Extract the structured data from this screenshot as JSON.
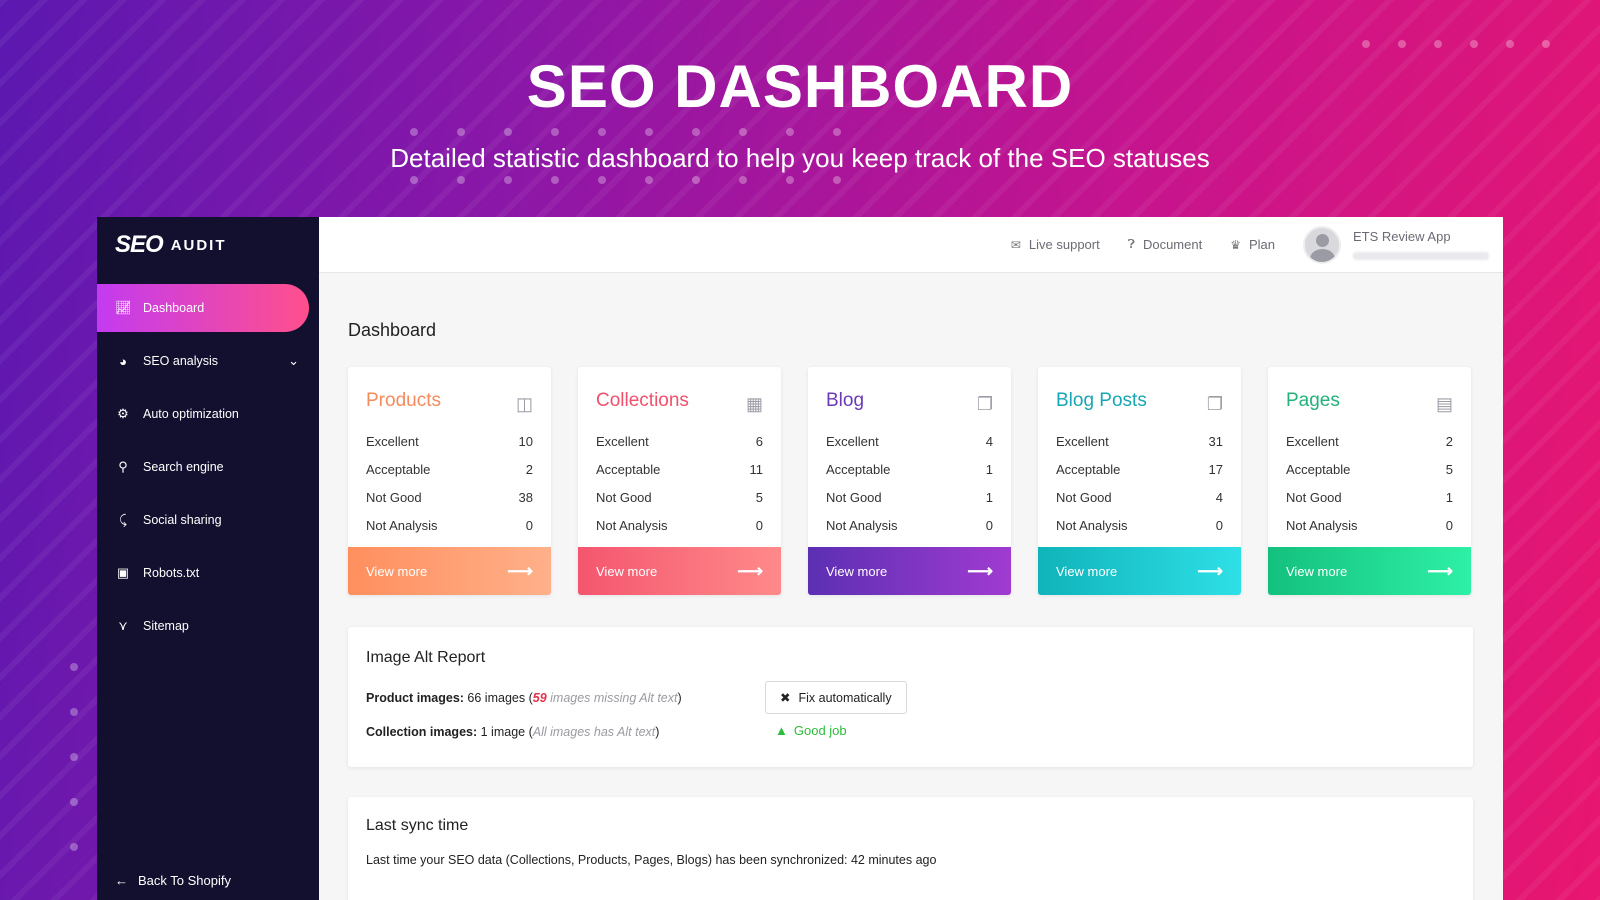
{
  "hero": {
    "title": "SEO DASHBOARD",
    "subtitle": "Detailed statistic dashboard to help you keep track of the SEO statuses"
  },
  "logo": {
    "part1": "SEO",
    "part2": "AUDIT"
  },
  "sidebar": {
    "items": [
      {
        "label": "Dashboard",
        "icon": "chart-icon",
        "active": true
      },
      {
        "label": "SEO analysis",
        "icon": "pie-icon",
        "has_chevron": true
      },
      {
        "label": "Auto optimization",
        "icon": "gears-icon"
      },
      {
        "label": "Search engine",
        "icon": "search-icon"
      },
      {
        "label": "Social sharing",
        "icon": "share-icon"
      },
      {
        "label": "Robots.txt",
        "icon": "robot-icon"
      },
      {
        "label": "Sitemap",
        "icon": "sitemap-icon"
      }
    ],
    "back_label": "Back To Shopify"
  },
  "topbar": {
    "live_support": "Live support",
    "document": "Document",
    "plan": "Plan",
    "user_name": "ETS Review App"
  },
  "page_title": "Dashboard",
  "cards": [
    {
      "title": "Products",
      "color": "#f48b5e",
      "foot_from": "#ff8f5e",
      "foot_to": "#ffb08a",
      "icon": "box-icon",
      "rows": [
        [
          "Excellent",
          "10"
        ],
        [
          "Acceptable",
          "2"
        ],
        [
          "Not Good",
          "38"
        ],
        [
          "Not Analysis",
          "0"
        ]
      ],
      "more": "View more"
    },
    {
      "title": "Collections",
      "color": "#f0506e",
      "foot_from": "#f4566f",
      "foot_to": "#ff8a8a",
      "icon": "boxes-icon",
      "rows": [
        [
          "Excellent",
          "6"
        ],
        [
          "Acceptable",
          "11"
        ],
        [
          "Not Good",
          "5"
        ],
        [
          "Not Analysis",
          "0"
        ]
      ],
      "more": "View more"
    },
    {
      "title": "Blog",
      "color": "#6a3ab8",
      "foot_from": "#5b2fb3",
      "foot_to": "#a03bd0",
      "icon": "copy-icon",
      "rows": [
        [
          "Excellent",
          "4"
        ],
        [
          "Acceptable",
          "1"
        ],
        [
          "Not Good",
          "1"
        ],
        [
          "Not Analysis",
          "0"
        ]
      ],
      "more": "View more"
    },
    {
      "title": "Blog Posts",
      "color": "#16a6b6",
      "foot_from": "#10b3ba",
      "foot_to": "#2ee0e6",
      "icon": "copy-icon",
      "rows": [
        [
          "Excellent",
          "31"
        ],
        [
          "Acceptable",
          "17"
        ],
        [
          "Not Good",
          "4"
        ],
        [
          "Not Analysis",
          "0"
        ]
      ],
      "more": "View more"
    },
    {
      "title": "Pages",
      "color": "#22b27a",
      "foot_from": "#14c07e",
      "foot_to": "#2ef0a6",
      "icon": "file-icon",
      "rows": [
        [
          "Excellent",
          "2"
        ],
        [
          "Acceptable",
          "5"
        ],
        [
          "Not Good",
          "1"
        ],
        [
          "Not Analysis",
          "0"
        ]
      ],
      "more": "View more"
    }
  ],
  "alt_report": {
    "title": "Image Alt Report",
    "product_label": "Product images:",
    "product_count": "66 images",
    "open_paren": " (",
    "missing_count": "59",
    "missing_text": " images missing Alt text",
    "close_paren": ")",
    "collection_label": "Collection images:",
    "collection_count": "1 image",
    "collection_note": "All images has Alt text",
    "fix_button": "Fix automatically",
    "good_job": "Good job"
  },
  "sync": {
    "title": "Last sync time",
    "text": "Last time your SEO data (Collections, Products, Pages, Blogs) has been synchronized: 42 minutes ago"
  }
}
